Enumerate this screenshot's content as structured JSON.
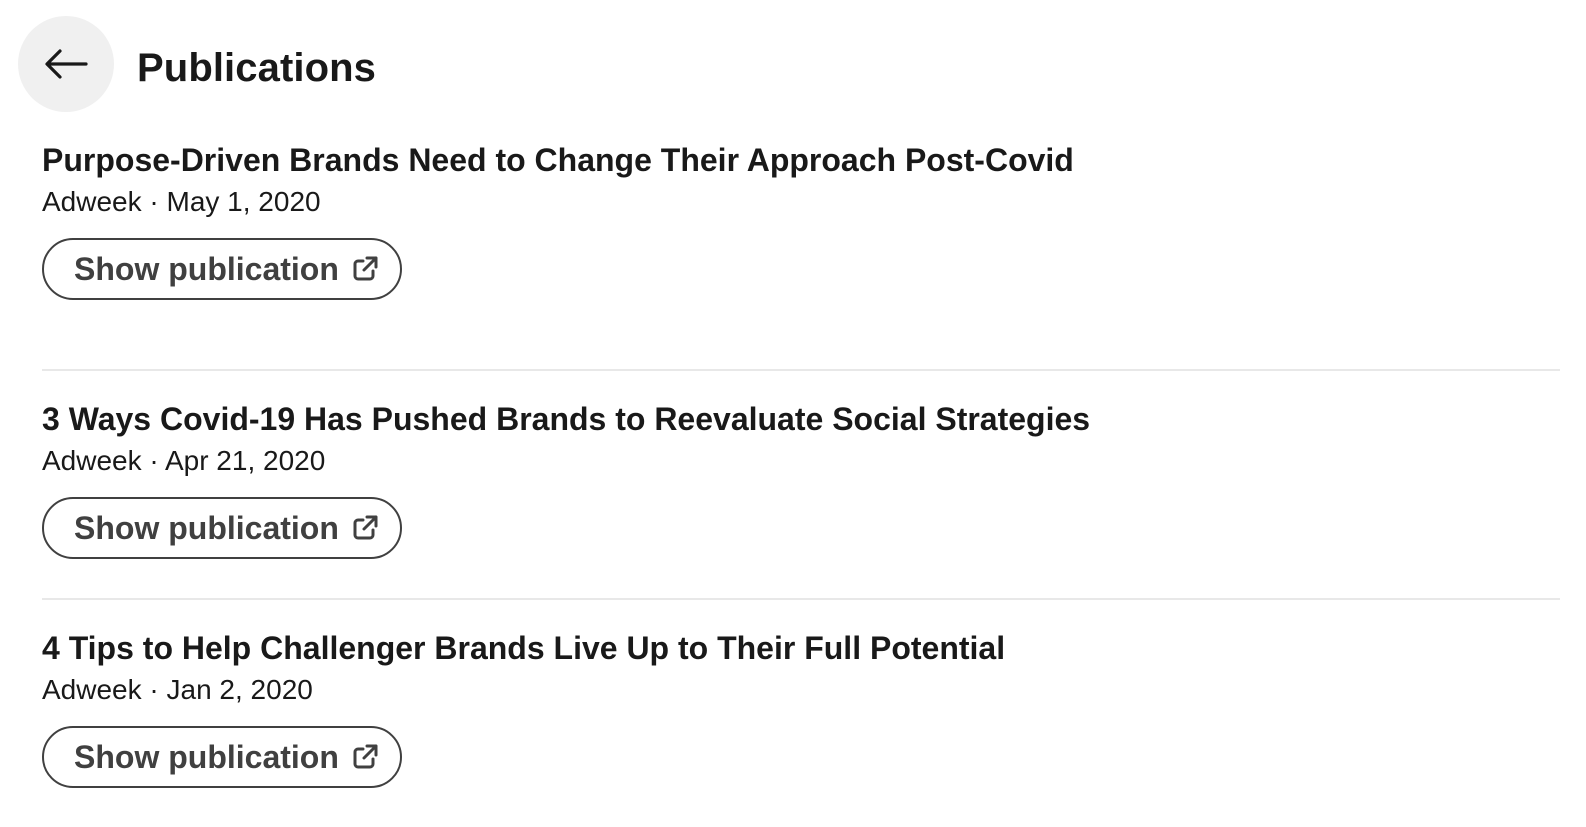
{
  "header": {
    "title": "Publications",
    "back_icon": "arrow-left-icon"
  },
  "publications": [
    {
      "title": "Purpose-Driven Brands Need to Change Their Approach Post-Covid",
      "meta": "Adweek · May 1, 2020",
      "button_label": "Show publication",
      "button_icon": "external-link-icon"
    },
    {
      "title": "3 Ways Covid-19 Has Pushed Brands to Reevaluate Social Strategies",
      "meta": "Adweek · Apr 21, 2020",
      "button_label": "Show publication",
      "button_icon": "external-link-icon"
    },
    {
      "title": "4 Tips to Help Challenger Brands Live Up to Their Full Potential",
      "meta": "Adweek · Jan 2, 2020",
      "button_label": "Show publication",
      "button_icon": "external-link-icon"
    }
  ],
  "colors": {
    "text": "#191919",
    "button_border": "#404040",
    "back_button_bg": "#f0f0f0",
    "divider": "#e8e8e8"
  }
}
